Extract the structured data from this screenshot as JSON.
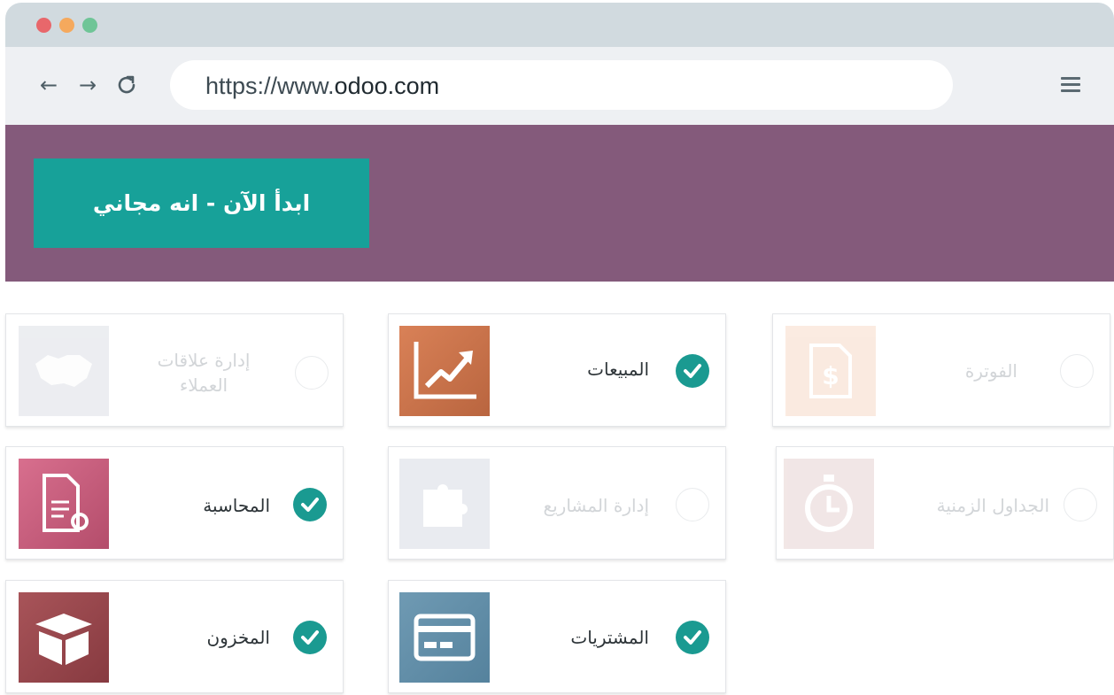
{
  "browser": {
    "url_prefix": "https://www.",
    "url_domain": "odoo.com"
  },
  "banner": {
    "cta_label": "ابدأ الآن - انه مجاني",
    "background": "#845a7b",
    "cta_color": "#17a199"
  },
  "apps": [
    {
      "label": "إدارة علاقات العملاء",
      "selected": false,
      "icon": "handshake-icon"
    },
    {
      "label": "المبيعات",
      "selected": true,
      "icon": "sales-chart-icon"
    },
    {
      "label": "الفوترة",
      "selected": false,
      "icon": "invoice-icon"
    },
    {
      "label": "المحاسبة",
      "selected": true,
      "icon": "accounting-document-icon"
    },
    {
      "label": "إدارة المشاريع",
      "selected": false,
      "icon": "puzzle-icon"
    },
    {
      "label": "الجداول الزمنية",
      "selected": false,
      "icon": "stopwatch-icon"
    },
    {
      "label": "المخزون",
      "selected": true,
      "icon": "box-icon"
    },
    {
      "label": "المشتريات",
      "selected": true,
      "icon": "credit-card-icon"
    }
  ],
  "check_color": "#1a9a91"
}
